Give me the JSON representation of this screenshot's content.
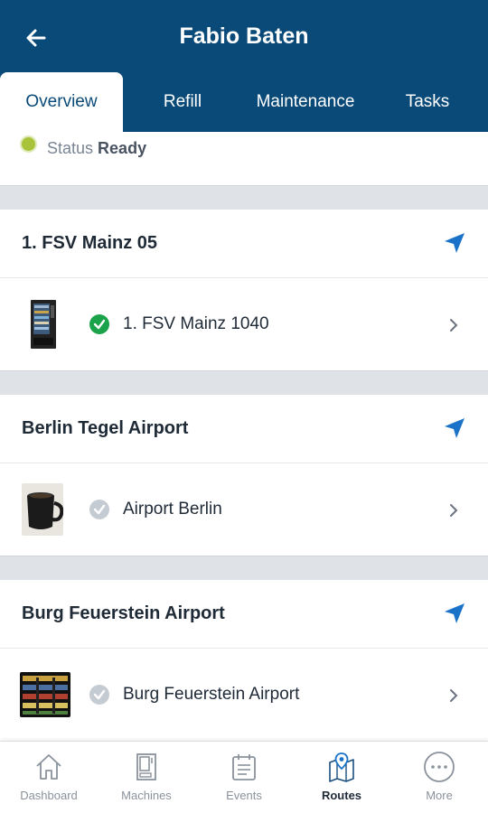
{
  "header": {
    "title": "Fabio Baten",
    "back_icon": "arrow-left-icon"
  },
  "tabs": [
    {
      "label": "Overview",
      "active": true
    },
    {
      "label": "Refill",
      "active": false
    },
    {
      "label": "Maintenance",
      "active": false
    },
    {
      "label": "Tasks",
      "active": false
    }
  ],
  "status": {
    "label": "Status",
    "value": "Ready",
    "dot_color": "#a8c33a"
  },
  "routes": [
    {
      "name": "1. FSV Mainz 05",
      "nav_icon": "navigation-arrow-icon",
      "machine": {
        "name": "1. FSV Mainz 1040",
        "state": "done",
        "thumb": "vending-machine-photo"
      }
    },
    {
      "name": "Berlin Tegel Airport",
      "nav_icon": "navigation-arrow-icon",
      "machine": {
        "name": "Airport Berlin",
        "state": "pending",
        "thumb": "coffee-mug-photo"
      }
    },
    {
      "name": "Burg Feuerstein Airport",
      "nav_icon": "navigation-arrow-icon",
      "machine": {
        "name": "Burg Feuerstein Airport",
        "state": "pending",
        "thumb": "snack-machine-photo"
      }
    }
  ],
  "bottom_nav": [
    {
      "label": "Dashboard",
      "icon": "home-icon",
      "active": false
    },
    {
      "label": "Machines",
      "icon": "vending-machine-icon",
      "active": false
    },
    {
      "label": "Events",
      "icon": "clipboard-icon",
      "active": false
    },
    {
      "label": "Routes",
      "icon": "map-pin-icon",
      "active": true
    },
    {
      "label": "More",
      "icon": "more-dots-icon",
      "active": false
    }
  ],
  "colors": {
    "header_bg": "#0a4a78",
    "accent": "#1a73c8",
    "success": "#1aa34a",
    "pending": "#c5cbd3"
  }
}
